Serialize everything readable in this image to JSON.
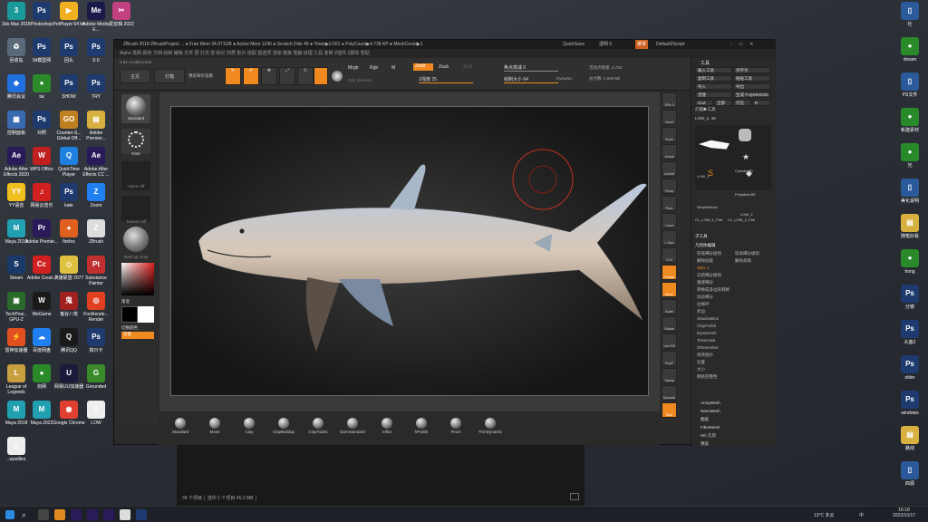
{
  "desktop_left": [
    {
      "label": "3ds Max 2018",
      "color": "#1a9a9a",
      "glyph": "3"
    },
    {
      "label": "Photoshop",
      "color": "#1e3a6e",
      "glyph": "Ps"
    },
    {
      "label": "PotPlayer 64 bit",
      "color": "#f0b020",
      "glyph": "▶"
    },
    {
      "label": "Adobe Media E...",
      "color": "#1a1a4a",
      "glyph": "Me"
    },
    {
      "label": "回收站",
      "color": "#5a6a7a",
      "glyph": "♻"
    },
    {
      "label": "3d模型网",
      "color": "#1e3a6e",
      "glyph": "Ps"
    },
    {
      "label": "回头",
      "color": "#1e3a6e",
      "glyph": "Ps"
    },
    {
      "label": "0-0",
      "color": "#1e3a6e",
      "glyph": "Ps"
    },
    {
      "label": "腾讯会议",
      "color": "#2070e0",
      "glyph": "◆"
    },
    {
      "label": "tai",
      "color": "#2a8a2a",
      "glyph": "●"
    },
    {
      "label": "SHOW",
      "color": "#1e3a6e",
      "glyph": "Ps"
    },
    {
      "label": "TRY",
      "color": "#1e3a6e",
      "glyph": "Ps"
    },
    {
      "label": "控制面板",
      "color": "#3a6ab0",
      "glyph": "▦"
    },
    {
      "label": "对照",
      "color": "#1e3a6e",
      "glyph": "Ps"
    },
    {
      "label": "Counter-S... Global Off...",
      "color": "#c08020",
      "glyph": "GO"
    },
    {
      "label": "Adobe Premier...",
      "color": "#d8b040",
      "glyph": "▤"
    },
    {
      "label": "Adobe After Effects 2020",
      "color": "#2a1a5a",
      "glyph": "Ae"
    },
    {
      "label": "WPS Office",
      "color": "#c02020",
      "glyph": "W"
    },
    {
      "label": "QuickTime Player",
      "color": "#2080e0",
      "glyph": "Q"
    },
    {
      "label": "Adobe After Effects CC ...",
      "color": "#2a1a5a",
      "glyph": "Ae"
    },
    {
      "label": "YY语音",
      "color": "#f0c020",
      "glyph": "YY"
    },
    {
      "label": "网易云音乐",
      "color": "#d02020",
      "glyph": "♫"
    },
    {
      "label": "kate",
      "color": "#1e3a6e",
      "glyph": "Ps"
    },
    {
      "label": "Zoom",
      "color": "#2080f0",
      "glyph": "Z"
    },
    {
      "label": "Maya 2019",
      "color": "#20a0b0",
      "glyph": "M"
    },
    {
      "label": "Adobe Premie...",
      "color": "#2a1a5a",
      "glyph": "Pr"
    },
    {
      "label": "firefox",
      "color": "#e06020",
      "glyph": "●"
    },
    {
      "label": "ZBrush",
      "color": "#ddd",
      "glyph": "Z"
    },
    {
      "label": "Steam",
      "color": "#1a3a6a",
      "glyph": "S"
    },
    {
      "label": "Adobe Creat...",
      "color": "#d02020",
      "glyph": "Cc"
    },
    {
      "label": "英雄联盟 2077",
      "color": "#e0c040",
      "glyph": "◇"
    },
    {
      "label": "Substance Painter",
      "color": "#c03030",
      "glyph": "Pt"
    },
    {
      "label": "TechPow... GPU-Z",
      "color": "#2a6a2a",
      "glyph": "▣"
    },
    {
      "label": "WeGame",
      "color": "#1a1a1a",
      "glyph": "W"
    },
    {
      "label": "鬼谷八荒",
      "color": "#a02020",
      "glyph": "鬼"
    },
    {
      "label": "FonRende... Render",
      "color": "#e04020",
      "glyph": "◎"
    },
    {
      "label": "雷神加速器",
      "color": "#e05020",
      "glyph": "⚡"
    },
    {
      "label": "百度网盘",
      "color": "#2080f0",
      "glyph": "☁"
    },
    {
      "label": "腾讯QQ",
      "color": "#1a1a1a",
      "glyph": "Q"
    },
    {
      "label": "搞只卡",
      "color": "#1e3a6e",
      "glyph": "Ps"
    },
    {
      "label": "League of Legends",
      "color": "#c8a040",
      "glyph": "L"
    },
    {
      "label": "剑网",
      "color": "#2a8a2a",
      "glyph": "●"
    },
    {
      "label": "网易UU加速器",
      "color": "#1a1a3a",
      "glyph": "U"
    },
    {
      "label": "Grounded",
      "color": "#3a8a2a",
      "glyph": "G"
    },
    {
      "label": "Maya 2018",
      "color": "#20a0b0",
      "glyph": "M"
    },
    {
      "label": "Maya 2022",
      "color": "#20a0b0",
      "glyph": "M"
    },
    {
      "label": "Google Chrome",
      "color": "#e04030",
      "glyph": "◉"
    },
    {
      "label": "LOW",
      "color": "#eee",
      "glyph": "▯"
    },
    {
      "label": "..wpsfiles",
      "color": "#eee",
      "glyph": "▯"
    }
  ],
  "desktop_top_extra": {
    "label": "爱剪辑 2022",
    "color": "#c04080",
    "glyph": "✂"
  },
  "desktop_right": [
    {
      "label": "社",
      "color": "#2a5a9a",
      "glyph": "▯"
    },
    {
      "label": "dream",
      "color": "#2a8a2a",
      "glyph": "●"
    },
    {
      "label": "PS文件",
      "color": "#2a5a9a",
      "glyph": "▯"
    },
    {
      "label": "新建素材",
      "color": "#2a8a2a",
      "glyph": "●"
    },
    {
      "label": "光",
      "color": "#2a8a2a",
      "glyph": "●"
    },
    {
      "label": "美化说明",
      "color": "#2a5a9a",
      "glyph": "▯"
    },
    {
      "label": "随笔好看",
      "color": "#d8b040",
      "glyph": "▤"
    },
    {
      "label": "hong",
      "color": "#2a8a2a",
      "glyph": "●"
    },
    {
      "label": "分镜",
      "color": "#1e3a6e",
      "glyph": "Ps"
    },
    {
      "label": "头盔2",
      "color": "#1e3a6e",
      "glyph": "Ps"
    },
    {
      "label": "older",
      "color": "#1e3a6e",
      "glyph": "Ps"
    },
    {
      "label": "windows",
      "color": "#1e3a6e",
      "glyph": "Ps"
    },
    {
      "label": "路线",
      "color": "#d8b040",
      "glyph": "▤"
    },
    {
      "label": "四源",
      "color": "#2a5a9a",
      "glyph": "▯"
    }
  ],
  "zbrush": {
    "title": "ZBrush 2018  ZBrushProject ... ● Free Mem 34.971GB ● Active Mem 1246 ● Scratch Disk 49 ● Timer▶0.001 ● PolyCount▶4.738 KP ● MeshCount▶1",
    "quicksave": "QuickSave",
    "transparency": "透明 0",
    "menus": "Default2Script",
    "menu_bar": "Alpha  笔刷  颜色  文档  绘制  编辑  文件  层  灯光  宏  标记  材质  影片  拾取  首选项  渲染  模板  笔触  纹理  工具  变换  Z插件  Z脚本  帮助",
    "coords": "0.81,-0.659,0.625",
    "home": "主页",
    "light": "灯箱",
    "preview": "预览布尔渲染",
    "draw_buttons": [
      "Edit",
      "Draw",
      "Move",
      "Scale",
      "Rotate"
    ],
    "mrgb": "Mrgb",
    "rgb": "Rgb",
    "m": "M",
    "rgb_intensity": "Rgb Intensity",
    "zadd": "Zadd",
    "zsub": "Zsub",
    "zcut": "Zcut",
    "z_intensity": "Z强度 25",
    "focal_shift": "焦点衰减 0",
    "draw_size": "绘制大小 64",
    "dynamic": "Dynamic",
    "active_points": "活动点数量: 4,734",
    "total_points": "总点数: 4,849 Mil",
    "left_shelf": [
      "Standard",
      "Dots",
      "Alpha Off",
      "Texture Off",
      "MatCap Gray"
    ],
    "gradient": "渐变",
    "switch_color": "切换颜色",
    "alternate": "交替",
    "right_shelf": [
      "SPix 3",
      "Scroll",
      "Zoom",
      "Actual",
      "AAHalf",
      "Persp",
      "Floor",
      "Local",
      "L.Sym",
      "XYZ",
      "Frame",
      "Move",
      "Scale",
      "Rotate",
      "Line Fill",
      "PolyF",
      "Transp",
      "Dynamic",
      "Solo"
    ],
    "tool_panel": {
      "header": "工具",
      "rows": [
        [
          "载入工具",
          "另存为"
        ],
        [
          "复制工具",
          "粘贴工具"
        ],
        [
          "导入",
          "导出"
        ],
        [
          "克隆",
          "生成 PolyMesh3D"
        ],
        [
          "GoZ",
          "全部",
          "可见",
          "R"
        ]
      ],
      "lightbox": "灯箱▶工具",
      "current": "LOW_2. 48",
      "tools": [
        "LOW_2",
        "Cylinder3D",
        "PolyMesh3D",
        "SimpleBrush",
        "CL_LOW_1_Flat",
        "CL_LOW_2_Flat",
        "LOW_2"
      ],
      "subtool": "子工具",
      "geometry": "几何体编辑",
      "geo_items": [
        "较低细分级别",
        "较高细分级别",
        "删除低级",
        "删除高级",
        "SDiv 1",
        "冻结细分级别",
        "重建细分",
        "转换成多边形网格",
        "动态细分",
        "边缘环",
        "折边",
        "ShadowBox",
        "ClayPolish",
        "Dynamesh",
        "Tessimate",
        "ZRemesher",
        "修改拓扑",
        "位置",
        "大小",
        "网格完整性"
      ],
      "zremesher_label": "拓扑网格",
      "edit_label": "变形",
      "smt": "平滑",
      "suv": "Suv",
      "reuv": "重建UV",
      "array_items": [
        "ArrayMesh",
        "NanoMesh",
        "图层",
        "FiberMesh",
        "HD 几何",
        "预览"
      ]
    },
    "brushes": [
      "Standard",
      "Move",
      "Clay",
      "ClayBuildup",
      "ClayTubes",
      "DamStandard",
      "Inflat",
      "hPolish",
      "Pinch",
      "TrimDynamic"
    ]
  },
  "explorer": {
    "status": "34 个项目 │ 选中 1 个项目 45.2 MB │"
  },
  "taskbar": {
    "weather": "13°C 多云",
    "time": "16:18",
    "date": "2022/10/17",
    "ime": "中"
  }
}
